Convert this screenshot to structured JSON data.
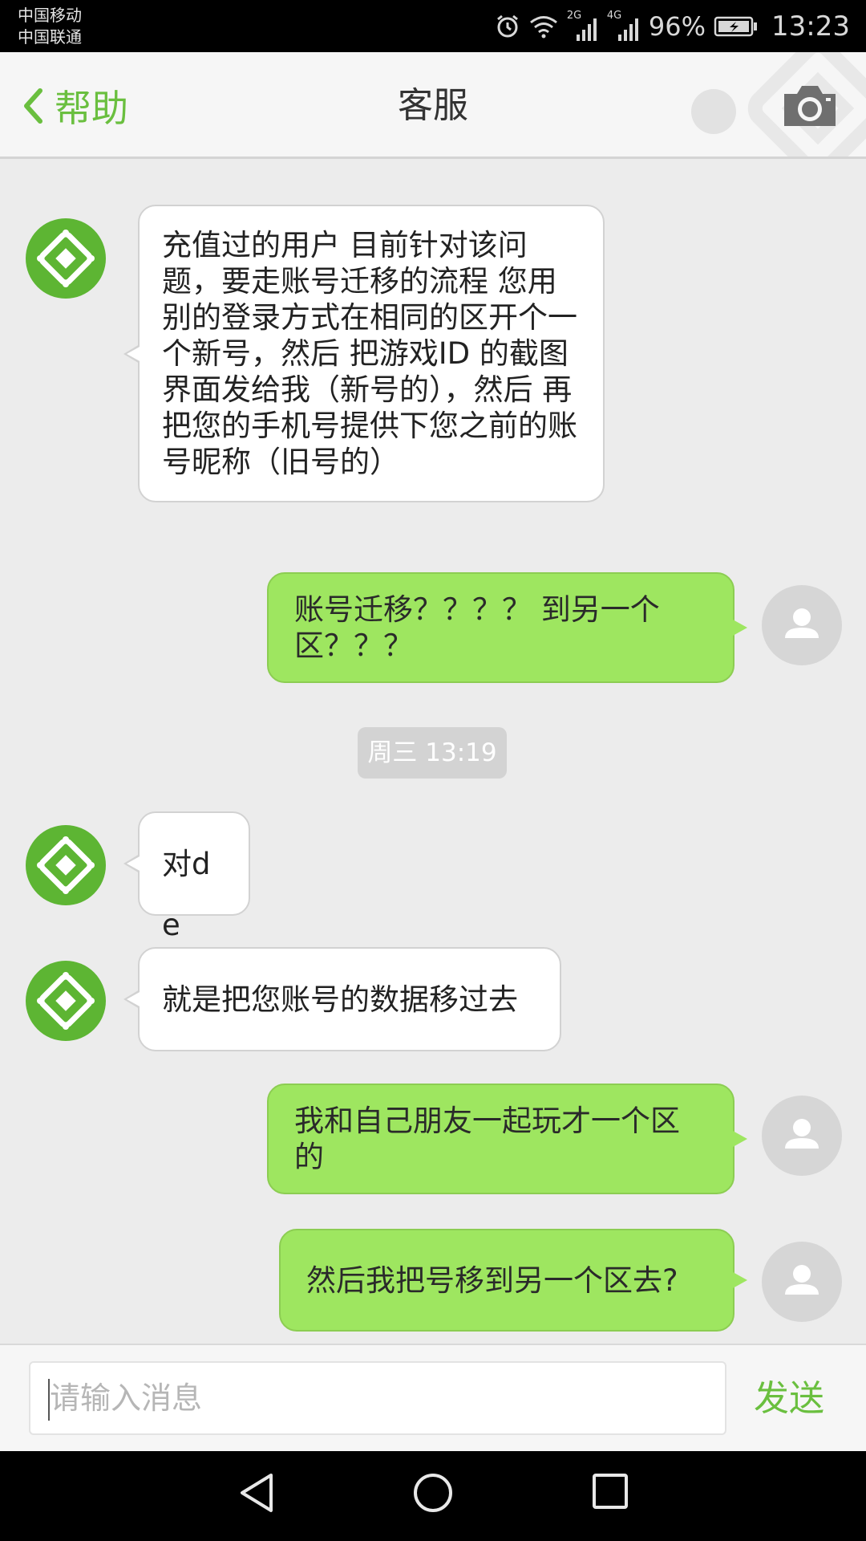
{
  "status_bar": {
    "carrier_1": "中国移动",
    "carrier_2": "中国联通",
    "network_2g": "2G",
    "network_4g": "4G",
    "battery": "96%",
    "time": "13:23"
  },
  "header": {
    "back_label": "帮助",
    "title": "客服",
    "accent_color": "#6abf3f"
  },
  "messages": [
    {
      "side": "left",
      "sender": "bot",
      "text": "充值过的用户 目前针对该问题，要走账号迁移的流程 您用别的登录方式在相同的区开个一个新号，然后 把游戏ID 的截图界面发给我（新号的），然后 再把您的手机号提供下您之前的账号昵称（旧号的）"
    },
    {
      "side": "right",
      "sender": "user",
      "text": "账号迁移？？？？ 到另一个区？？？"
    },
    {
      "side": "left",
      "sender": "bot",
      "text": "对de"
    },
    {
      "side": "left",
      "sender": "bot",
      "text": "就是把您账号的数据移过去"
    },
    {
      "side": "right",
      "sender": "user",
      "text": "我和自己朋友一起玩才一个区的"
    },
    {
      "side": "right",
      "sender": "user",
      "text": "然后我把号移到另一个区去?"
    }
  ],
  "timestamp": "周三 13:19",
  "input": {
    "placeholder": "请输入消息",
    "value": ""
  },
  "send_label": "发送",
  "colors": {
    "bot_avatar": "#5db533",
    "user_bubble": "#9ee660",
    "chat_background": "#ececec"
  }
}
